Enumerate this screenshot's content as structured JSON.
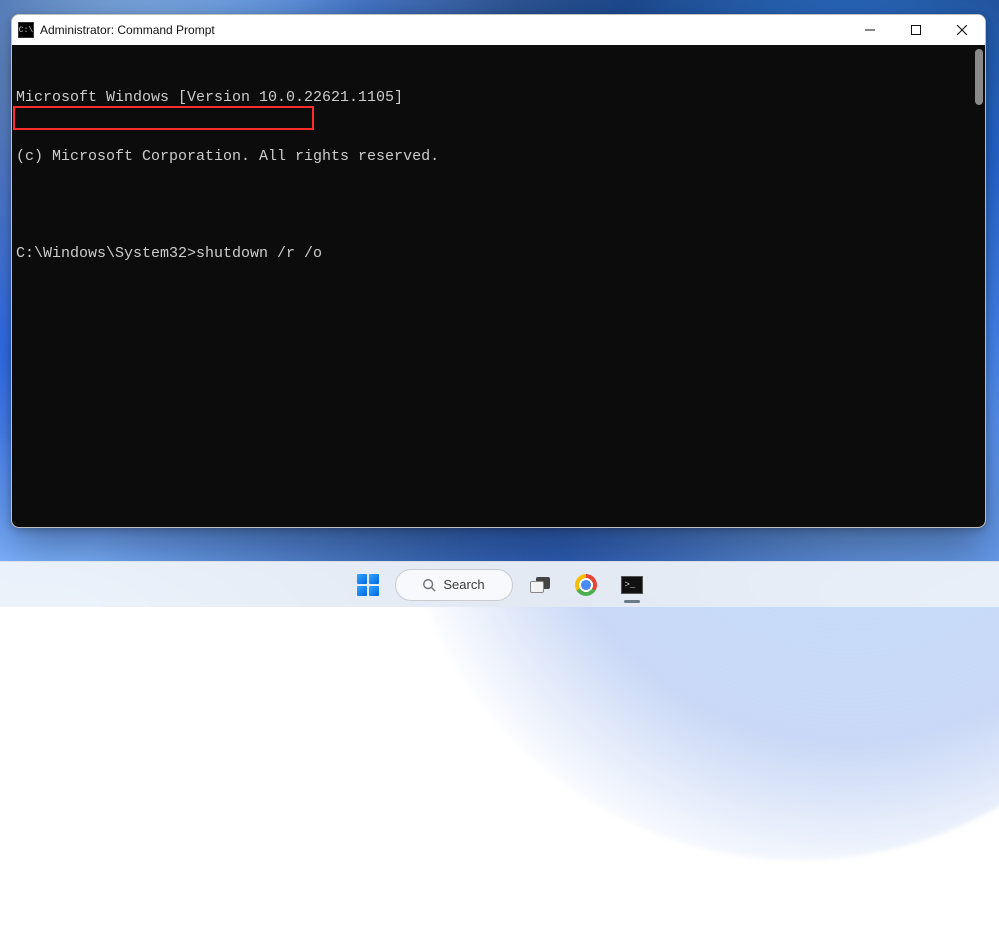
{
  "window": {
    "title": "Administrator: Command Prompt"
  },
  "terminal": {
    "line1": "Microsoft Windows [Version 10.0.22621.1105]",
    "line2": "(c) Microsoft Corporation. All rights reserved.",
    "blank": "",
    "prompt": "C:\\Windows\\System32>",
    "command": "shutdown /r /o"
  },
  "taskbar": {
    "search_label": "Search"
  },
  "icons": {
    "app": "C:\\",
    "cmd": ">_"
  }
}
